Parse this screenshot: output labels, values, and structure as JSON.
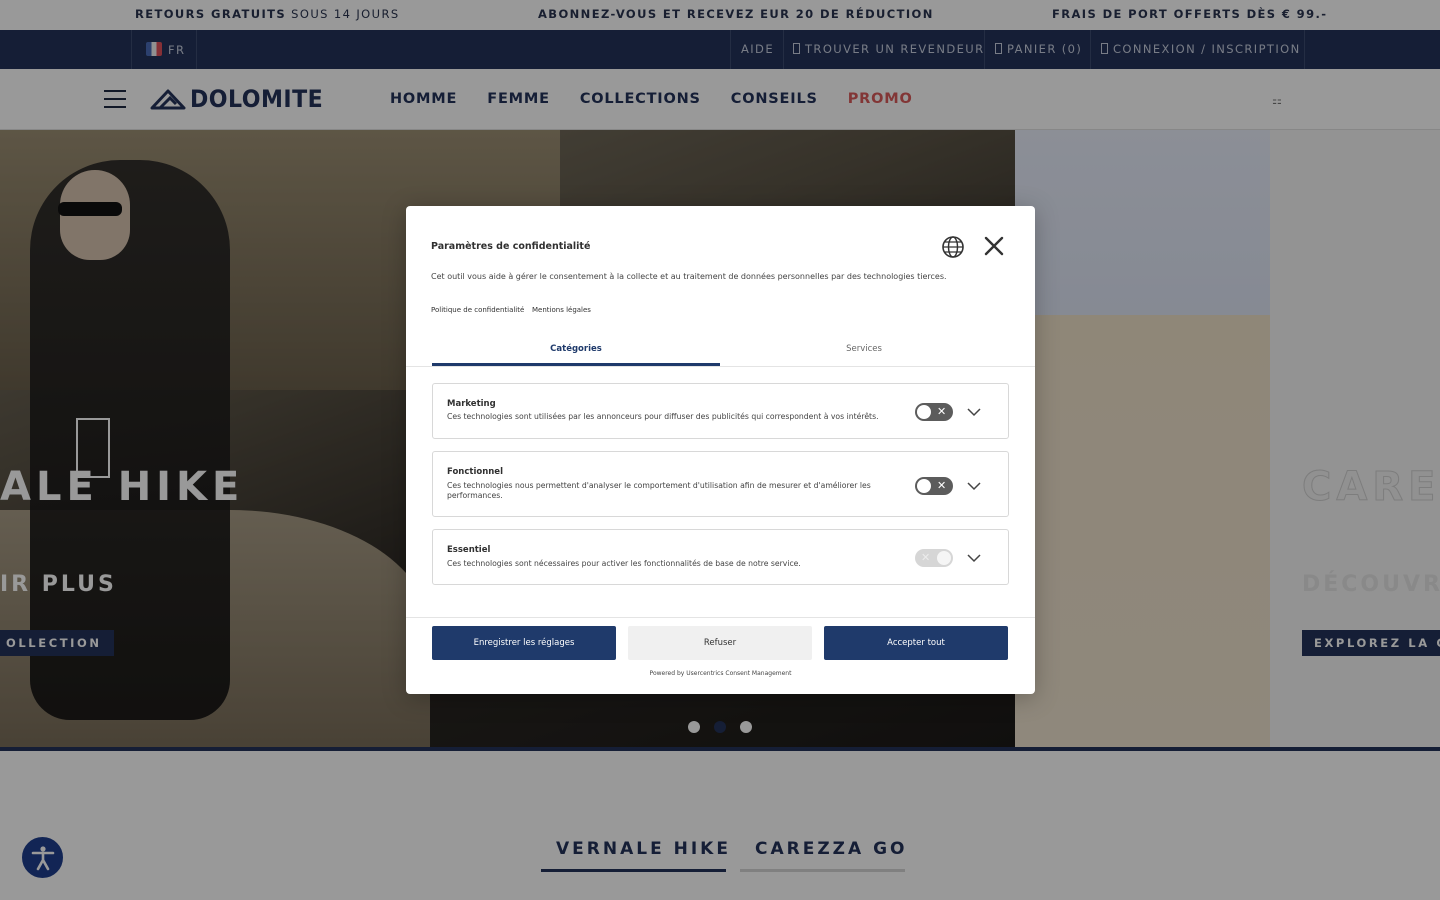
{
  "promo_bar": {
    "item1_bold": "RETOURS GRATUITS",
    "item1_light": " SOUS 14 JOURS",
    "item2": "ABONNEZ-VOUS ET RECEVEZ EUR 20 DE RÉDUCTION",
    "item3": "FRAIS DE PORT OFFERTS DÈS € 99.-"
  },
  "utility_bar": {
    "language": "FR",
    "help": "AIDE",
    "find_dealer": "TROUVER UN REVENDEUR",
    "cart": "PANIER (0)",
    "login": "CONNEXION / INSCRIPTION"
  },
  "main_nav": {
    "logo": "DOLOMITE",
    "links": [
      "HOMME",
      "FEMME",
      "COLLECTIONS",
      "CONSEILS"
    ],
    "promo": "PROMO",
    "grid_icon_glyph": "⚏"
  },
  "hero": {
    "slide1_title": "ALE HIKE",
    "slide1_subtitle": "IR PLUS",
    "slide1_button": "OLLECTION",
    "slide3_title": "CAREZ",
    "slide3_subtitle": "DÉCOUVR",
    "slide3_button": "EXPLOREZ LA CO"
  },
  "tabs": {
    "tab1": "VERNALE HIKE",
    "tab2": "CAREZZA GO"
  },
  "consent": {
    "title": "Paramètres de confidentialité",
    "description": "Cet outil vous aide à gérer le consentement à la collecte et au traitement de données personnelles par des technologies tierces.",
    "privacy_link": "Politique de confidentialité",
    "legal_link": "Mentions légales",
    "tab_categories": "Catégories",
    "tab_services": "Services",
    "categories": [
      {
        "name": "Marketing",
        "description": "Ces technologies sont utilisées par les annonceurs pour diffuser des publicités qui correspondent à vos intérêts."
      },
      {
        "name": "Fonctionnel",
        "description": "Ces technologies nous permettent d'analyser le comportement d'utilisation afin de mesurer et d'améliorer les performances."
      },
      {
        "name": "Essentiel",
        "description": "Ces technologies sont nécessaires pour activer les fonctionnalités de base de notre service."
      }
    ],
    "toggle_off_mark": "✕",
    "btn_save": "Enregistrer les réglages",
    "btn_refuse": "Refuser",
    "btn_accept": "Accepter tout",
    "powered_by": "Powered by Usercentrics Consent Management"
  },
  "colors": {
    "brand_navy": "#24335a",
    "promo_red": "#d95a5a",
    "consent_primary": "#1f3a6b"
  }
}
